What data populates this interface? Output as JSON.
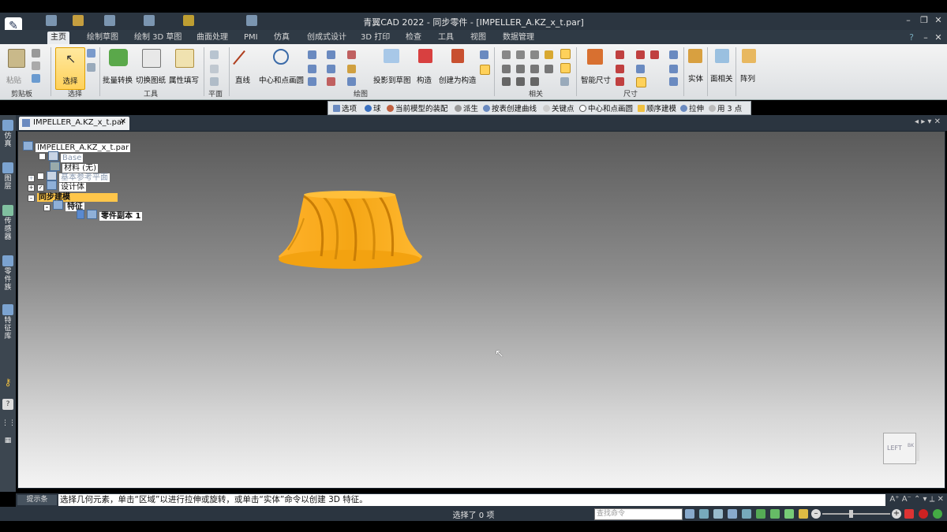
{
  "window": {
    "title": "青翼CAD 2022 - 同步零件 - [IMPELLER_A.KZ_x_t.par]"
  },
  "ribbon_tabs": [
    "主页",
    "绘制草图",
    "绘制 3D 草图",
    "曲面处理",
    "PMI",
    "仿真",
    "创成式设计",
    "3D 打印",
    "检查",
    "工具",
    "视图",
    "数据管理"
  ],
  "ribbon": {
    "groups": [
      "剪贴板",
      "选择",
      "工具",
      "平面",
      "绘图",
      "相关",
      "尺寸"
    ],
    "clipboard_paste": "粘贴",
    "select": "选择",
    "batch_convert": "批量转换",
    "switch_drawing": "切换图纸",
    "attr_fill": "属性填写",
    "line": "直线",
    "center_circle": "中心和点画圆",
    "project_sketch": "投影到草图",
    "construct": "构造",
    "create_construct": "创建为构造",
    "smart_dim": "智能尺寸",
    "solid": "实体",
    "face_related": "面相关",
    "array": "阵列"
  },
  "selection_bar": [
    "选项",
    "球",
    "当前模型的装配",
    "派生",
    "按表创建曲线",
    "关键点",
    "中心和点画圆",
    "顺序建模",
    "拉伸",
    "用 3 点"
  ],
  "left_dock": [
    "仿真",
    "图层",
    "传感器",
    "零件族",
    "特征库"
  ],
  "document_tab": "IMPELLER_A.KZ_x_t.par",
  "tree": {
    "root": "IMPELLER_A.KZ_x_t.par",
    "items": [
      "Base",
      "材料 (无)",
      "基本参考平面",
      "设计体",
      "同步建模",
      "特征",
      "零件副本 1"
    ]
  },
  "viewcube": {
    "face": "LEFT",
    "side": "BK"
  },
  "prompt": {
    "label": "提示条",
    "text": "选择几何元素，单击“区域”以进行拉伸或旋转，或单击“实体”命令以创建 3D 特征。"
  },
  "status": {
    "selection": "选择了 0 项",
    "find_placeholder": "查找命令"
  },
  "colors": {
    "model": "#f5a615",
    "accent": "#ffd15a",
    "titlebar": "#2b3540"
  },
  "icons": [
    "app-logo-icon",
    "paste-icon",
    "cursor-icon",
    "batch-convert-icon",
    "switch-drawing-icon",
    "attribute-icon",
    "line-icon",
    "circle-icon",
    "projection-icon",
    "construct-icon",
    "smart-dimension-icon",
    "solid-icon",
    "face-icon",
    "array-icon",
    "viewcube-icon"
  ]
}
